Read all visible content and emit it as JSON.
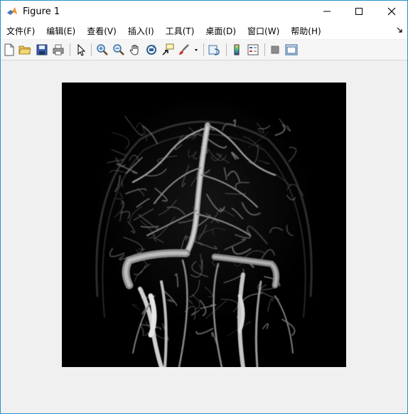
{
  "window": {
    "title": "Figure 1"
  },
  "menu": [
    {
      "id": "file",
      "label": "文件(F)"
    },
    {
      "id": "edit",
      "label": "编辑(E)"
    },
    {
      "id": "view",
      "label": "查看(V)"
    },
    {
      "id": "insert",
      "label": "插入(I)"
    },
    {
      "id": "tools",
      "label": "工具(T)"
    },
    {
      "id": "desktop",
      "label": "桌面(D)"
    },
    {
      "id": "window",
      "label": "窗口(W)"
    },
    {
      "id": "help",
      "label": "帮助(H)"
    }
  ],
  "toolbar_icons": [
    "new-figure-icon",
    "open-file-icon",
    "save-icon",
    "print-icon",
    "pointer-icon",
    "zoom-in-icon",
    "zoom-out-icon",
    "pan-icon",
    "rotate-3d-icon",
    "data-cursor-icon",
    "brush-icon",
    "link-plot-icon",
    "colorbar-icon",
    "legend-icon",
    "hide-plot-tools-icon",
    "show-plot-tools-icon"
  ],
  "image": {
    "subject": "angiography"
  }
}
